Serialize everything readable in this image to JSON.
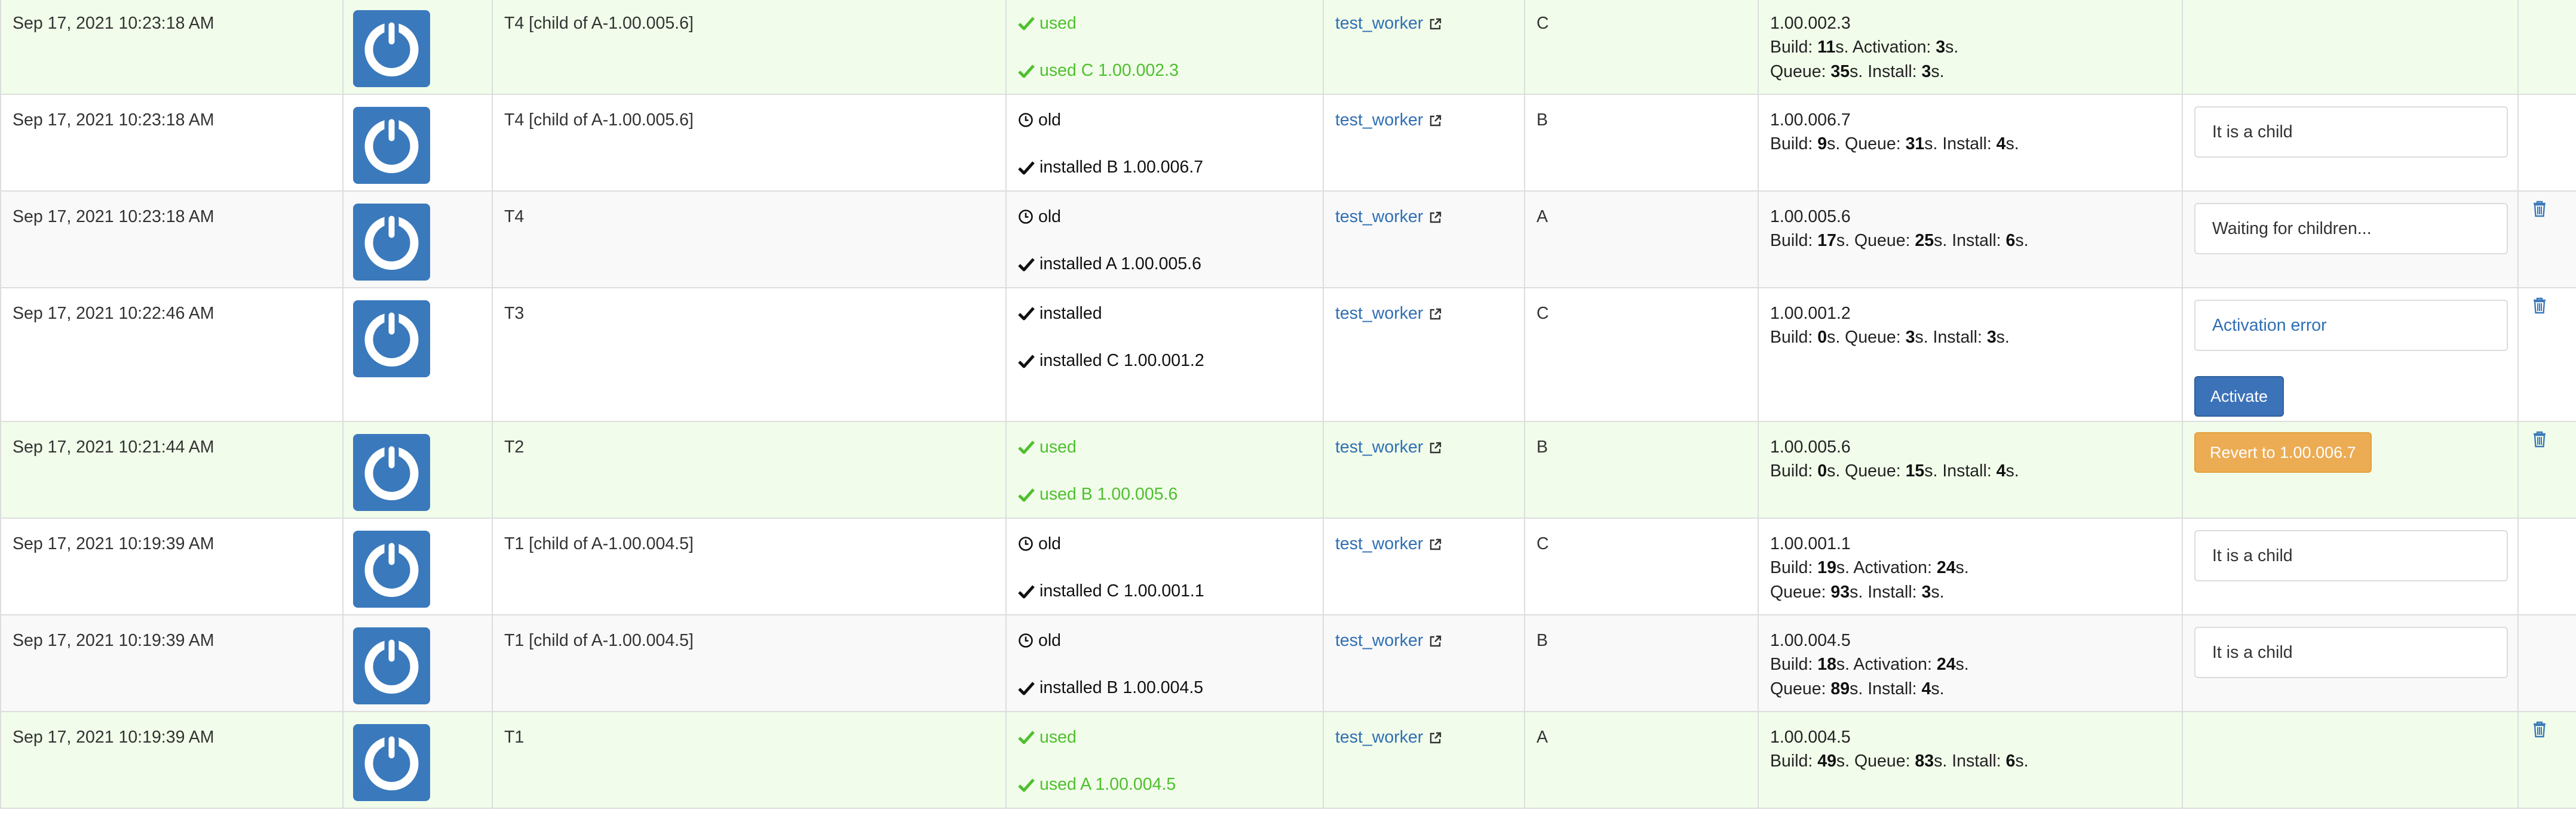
{
  "colors": {
    "used": "#4fbf2f",
    "link": "#2f6fb5",
    "activate": "#3c73b8",
    "revert": "#ecac54",
    "used_row_bg": "#f1fdea"
  },
  "icons": {
    "app_logo": "power-icon",
    "external": "external-link-icon",
    "used": "check-icon",
    "old": "clock-icon",
    "installed": "check-icon",
    "delete": "trash-icon"
  },
  "rows": [
    {
      "timestamp": "Sep 17, 2021 10:23:18 AM",
      "name": "T4 [child of A-1.00.005.6]",
      "status": "used",
      "detail": "used C 1.00.002.3",
      "worker": "test_worker",
      "group": "C",
      "version": "1.00.002.3",
      "times": [
        "Build: ",
        "11",
        "s. Activation: ",
        "3",
        "s.",
        "Queue: ",
        "35",
        "s. Install: ",
        "3",
        "s."
      ]
    },
    {
      "timestamp": "Sep 17, 2021 10:23:18 AM",
      "name": "T4 [child of A-1.00.005.6]",
      "status": "old",
      "detail": "installed B 1.00.006.7",
      "worker": "test_worker",
      "group": "B",
      "version": "1.00.006.7",
      "note": "It is a child"
    },
    {
      "timestamp": "Sep 17, 2021 10:23:18 AM",
      "name": "T4",
      "status": "old",
      "detail": "installed A 1.00.005.6",
      "worker": "test_worker",
      "group": "A",
      "version": "1.00.005.6",
      "note": "Waiting for children..."
    },
    {
      "timestamp": "Sep 17, 2021 10:22:46 AM",
      "name": "T3",
      "status": "installed",
      "detail": "installed C 1.00.001.2",
      "worker": "test_worker",
      "group": "C",
      "version": "1.00.001.2",
      "note": "Activation error",
      "button": "Activate"
    },
    {
      "timestamp": "Sep 17, 2021 10:21:44 AM",
      "name": "T2",
      "status": "used",
      "detail": "used B 1.00.005.6",
      "worker": "test_worker",
      "group": "B",
      "version": "1.00.005.6",
      "button": "Revert to 1.00.006.7"
    },
    {
      "timestamp": "Sep 17, 2021 10:19:39 AM",
      "name": "T1 [child of A-1.00.004.5]",
      "status": "old",
      "detail": "installed C 1.00.001.1",
      "worker": "test_worker",
      "group": "C",
      "version": "1.00.001.1",
      "note": "It is a child"
    },
    {
      "timestamp": "Sep 17, 2021 10:19:39 AM",
      "name": "T1 [child of A-1.00.004.5]",
      "status": "old",
      "detail": "installed B 1.00.004.5",
      "worker": "test_worker",
      "group": "B",
      "version": "1.00.004.5",
      "note": "It is a child"
    },
    {
      "timestamp": "Sep 17, 2021 10:19:39 AM",
      "name": "T1",
      "status": "used",
      "detail": "used A 1.00.004.5",
      "worker": "test_worker",
      "group": "A",
      "version": "1.00.004.5"
    }
  ],
  "times": {
    "r1": {
      "b": "9",
      "q": "31",
      "i": "4"
    },
    "r2": {
      "b": "17",
      "q": "25",
      "i": "6"
    },
    "r3": {
      "b": "0",
      "q": "3",
      "i": "3"
    },
    "r4": {
      "b": "0",
      "q": "15",
      "i": "4"
    },
    "r5": {
      "b": "19",
      "a": "24",
      "q": "93",
      "i": "3"
    },
    "r6": {
      "b": "18",
      "a": "24",
      "q": "89",
      "i": "4"
    },
    "r7": {
      "b": "49",
      "q": "83",
      "i": "6"
    }
  }
}
